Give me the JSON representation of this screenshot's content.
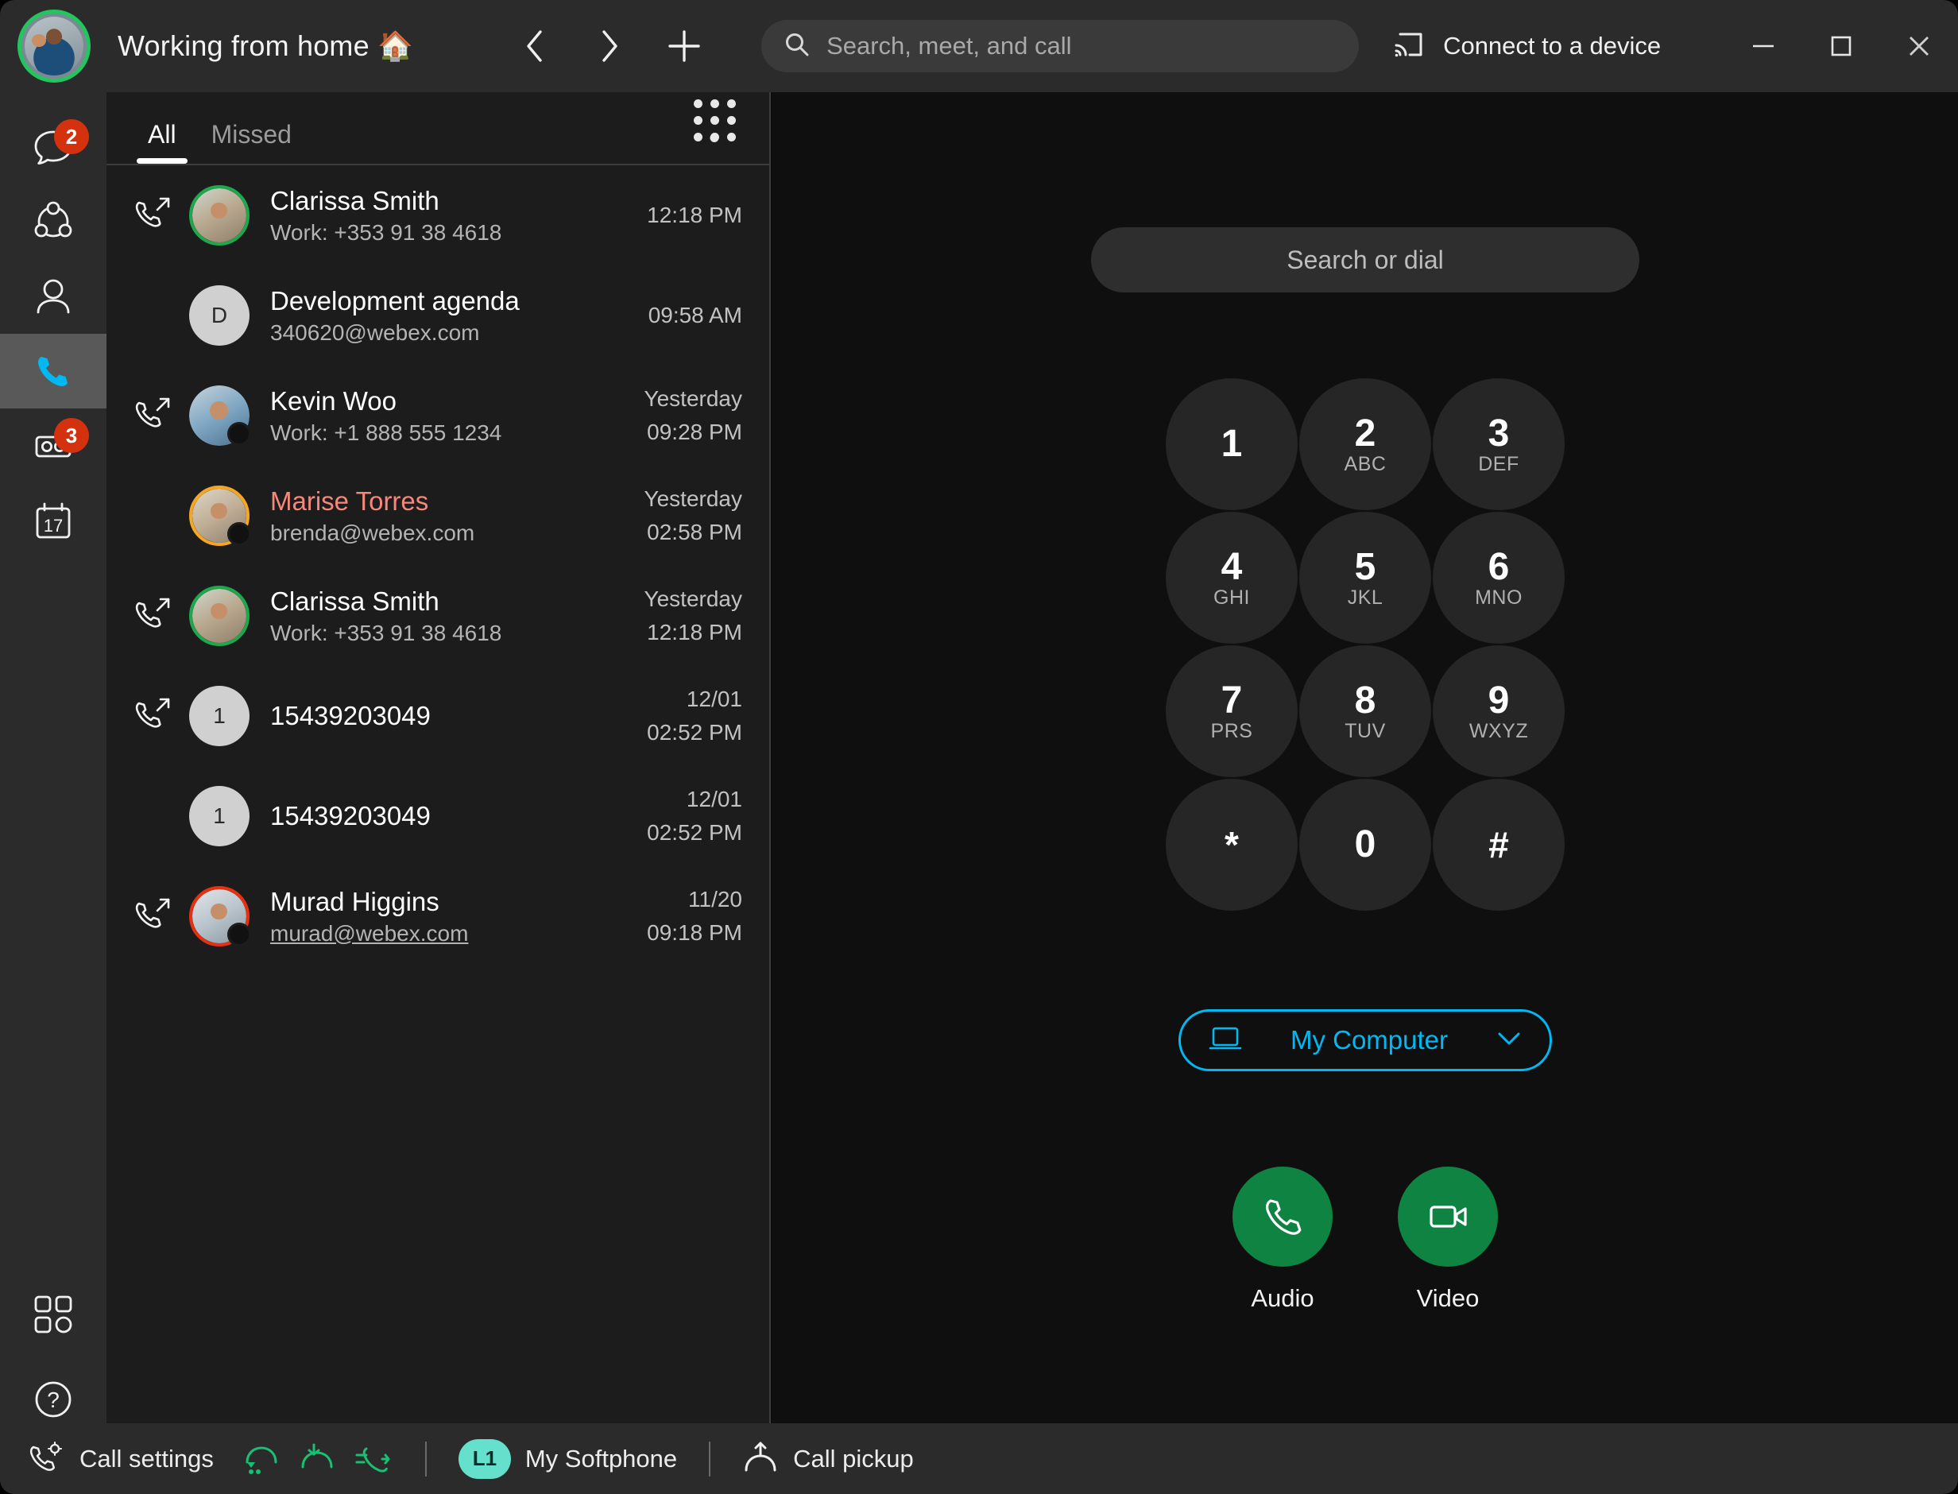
{
  "titlebar": {
    "status_text": "Working from home 🏠",
    "avatar_name": "user-avatar",
    "presence_ring_color": "#22c55e",
    "back_label": "Back",
    "forward_label": "Forward",
    "new_label": "New",
    "search": {
      "placeholder": "Search, meet, and call",
      "value": ""
    },
    "connect_device_label": "Connect to a device",
    "minimize_label": "Minimize",
    "maximize_label": "Maximize",
    "close_label": "Close"
  },
  "rail": {
    "items": [
      {
        "name": "messaging",
        "badge": "2",
        "active": false
      },
      {
        "name": "teams",
        "badge": "",
        "active": false
      },
      {
        "name": "contacts",
        "badge": "",
        "active": false
      },
      {
        "name": "calling",
        "badge": "",
        "active": true
      },
      {
        "name": "voicemail",
        "badge": "3",
        "active": false
      },
      {
        "name": "meetings",
        "badge": "",
        "active": false
      }
    ],
    "calendar_day": "17",
    "apps_label": "Apps",
    "help_label": "Help",
    "active_accent": "#00b9f2"
  },
  "calls_panel": {
    "tabs": [
      {
        "label": "All",
        "active": true
      },
      {
        "label": "Missed",
        "active": false
      }
    ],
    "dialpad_toggle_label": "Show dialpad",
    "rows": [
      {
        "name": "Clarissa Smith",
        "sub": "Work: +353 91 38 4618",
        "sub_is_link": false,
        "time_primary": "",
        "time_secondary": "12:18 PM",
        "direction": "outgoing",
        "missed": false,
        "avatar_kind": "photo",
        "avatar_ring": "green",
        "avatar_style": "ph-a",
        "presence": "none",
        "initial": ""
      },
      {
        "name": "Development agenda",
        "sub": "340620@webex.com",
        "sub_is_link": false,
        "time_primary": "",
        "time_secondary": "09:58 AM",
        "direction": "none",
        "missed": false,
        "avatar_kind": "initial",
        "avatar_ring": "none",
        "avatar_style": "",
        "presence": "none",
        "initial": "D"
      },
      {
        "name": "Kevin Woo",
        "sub": "Work: +1 888 555 1234",
        "sub_is_link": false,
        "time_primary": "Yesterday",
        "time_secondary": "09:28 PM",
        "direction": "outgoing",
        "missed": false,
        "avatar_kind": "photo",
        "avatar_ring": "none",
        "avatar_style": "ph-b",
        "presence": "offline",
        "initial": ""
      },
      {
        "name": "Marise Torres",
        "sub": "brenda@webex.com",
        "sub_is_link": false,
        "time_primary": "Yesterday",
        "time_secondary": "02:58 PM",
        "direction": "none",
        "missed": true,
        "avatar_kind": "photo",
        "avatar_ring": "orange",
        "avatar_style": "ph-c",
        "presence": "offline",
        "initial": ""
      },
      {
        "name": "Clarissa Smith",
        "sub": "Work: +353 91 38 4618",
        "sub_is_link": false,
        "time_primary": "Yesterday",
        "time_secondary": "12:18 PM",
        "direction": "outgoing",
        "missed": false,
        "avatar_kind": "photo",
        "avatar_ring": "green",
        "avatar_style": "ph-a",
        "presence": "none",
        "initial": ""
      },
      {
        "name": "15439203049",
        "sub": "",
        "sub_is_link": false,
        "time_primary": "12/01",
        "time_secondary": "02:52 PM",
        "direction": "outgoing",
        "missed": false,
        "avatar_kind": "initial",
        "avatar_ring": "none",
        "avatar_style": "",
        "presence": "none",
        "initial": "1"
      },
      {
        "name": "15439203049",
        "sub": "",
        "sub_is_link": false,
        "time_primary": "12/01",
        "time_secondary": "02:52 PM",
        "direction": "none",
        "missed": false,
        "avatar_kind": "initial",
        "avatar_ring": "none",
        "avatar_style": "",
        "presence": "none",
        "initial": "1"
      },
      {
        "name": "Murad Higgins",
        "sub": "murad@webex.com",
        "sub_is_link": true,
        "time_primary": "11/20",
        "time_secondary": "09:18 PM",
        "direction": "outgoing",
        "missed": false,
        "avatar_kind": "photo",
        "avatar_ring": "red",
        "avatar_style": "ph-d",
        "presence": "offline",
        "initial": ""
      }
    ]
  },
  "dialpad": {
    "input_placeholder": "Search or dial",
    "input_value": "",
    "keys": [
      {
        "num": "1",
        "sub": ""
      },
      {
        "num": "2",
        "sub": "ABC"
      },
      {
        "num": "3",
        "sub": "DEF"
      },
      {
        "num": "4",
        "sub": "GHI"
      },
      {
        "num": "5",
        "sub": "JKL"
      },
      {
        "num": "6",
        "sub": "MNO"
      },
      {
        "num": "7",
        "sub": "PRS"
      },
      {
        "num": "8",
        "sub": "TUV"
      },
      {
        "num": "9",
        "sub": "WXYZ"
      },
      {
        "num": "*",
        "sub": ""
      },
      {
        "num": "0",
        "sub": ""
      },
      {
        "num": "#",
        "sub": ""
      }
    ],
    "device_selector": {
      "label": "My Computer",
      "accent": "#00b9f2"
    },
    "audio_label": "Audio",
    "video_label": "Video",
    "call_button_color": "#0f8342"
  },
  "statusbar": {
    "call_settings_label": "Call settings",
    "feature_icons": [
      {
        "name": "call-forward-icon",
        "color": "#16c172"
      },
      {
        "name": "do-not-disturb-icon",
        "color": "#16c172"
      },
      {
        "name": "call-transfer-icon",
        "color": "#16c172"
      }
    ],
    "line_badge": "L1",
    "line_label": "My Softphone",
    "call_pickup_label": "Call pickup"
  }
}
